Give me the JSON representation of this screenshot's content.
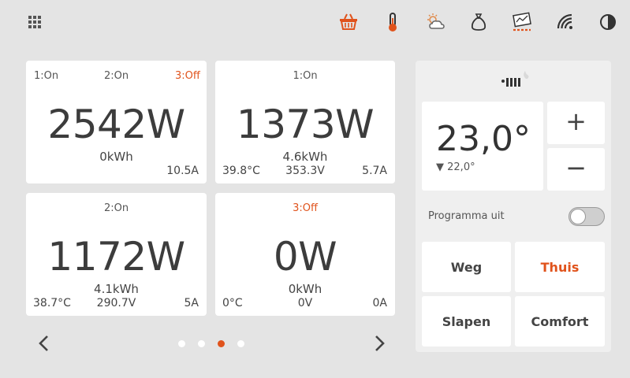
{
  "topbar": {
    "icons": [
      "apps-grid-icon",
      "basket-icon",
      "thermometer-icon",
      "weather-icon",
      "money-bag-icon",
      "price-ticket-icon",
      "wifi-icon",
      "contrast-icon"
    ],
    "accent": "#e0531c"
  },
  "cards": [
    {
      "labels": [
        "1:On",
        "2:On",
        "3:Off"
      ],
      "power": "2542W",
      "energy": "0kWh",
      "current": "10.5A"
    },
    {
      "labels": [
        "1:On"
      ],
      "power": "1373W",
      "energy": "4.6kWh",
      "temp": "39.8°C",
      "voltage": "353.3V",
      "current": "5.7A"
    },
    {
      "labels": [
        "2:On"
      ],
      "power": "1172W",
      "energy": "4.1kWh",
      "temp": "38.7°C",
      "voltage": "290.7V",
      "current": "5A"
    },
    {
      "labels": [
        "3:Off"
      ],
      "power": "0W",
      "energy": "0kWh",
      "temp": "0°C",
      "voltage": "0V",
      "current": "0A"
    }
  ],
  "pagination": {
    "count": 4,
    "active": 3
  },
  "thermostat": {
    "setpoint": "23,0°",
    "current": "22,0°",
    "plus": "+",
    "minus": "−",
    "program_label": "Programma uit",
    "program_on": false,
    "modes": [
      "Weg",
      "Thuis",
      "Slapen",
      "Comfort"
    ],
    "active_mode": "Thuis"
  }
}
